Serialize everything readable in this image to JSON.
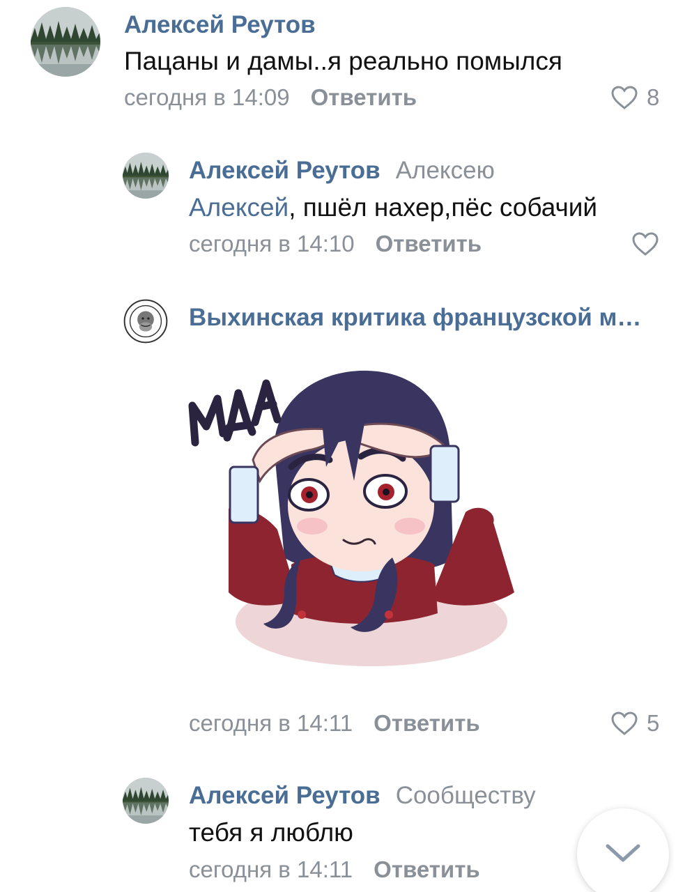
{
  "comments": [
    {
      "author": "Алексей Реутов",
      "text": "Пацаны и дамы..я реально помылся",
      "time": "сегодня в 14:09",
      "reply_label": "Ответить",
      "likes": "8"
    },
    {
      "author": "Алексей Реутов",
      "reply_to": "Алексею",
      "mention": "Алексей",
      "text": ", пшёл нахер,пёс собачий",
      "time": "сегодня в 14:10",
      "reply_label": "Ответить"
    },
    {
      "author": "Выхинская критика французской м…",
      "sticker_text": "МДА",
      "time": "сегодня в 14:11",
      "reply_label": "Ответить",
      "likes": "5"
    },
    {
      "author": "Алексей Реутов",
      "reply_to": "Сообществу",
      "text": "тебя я люблю",
      "time": "сегодня в 14:11",
      "reply_label": "Ответить"
    }
  ],
  "colors": {
    "link": "#4a6d96",
    "secondary": "#8a9097",
    "text": "#111111"
  },
  "icons": {
    "like": "heart-outline-icon",
    "scroll": "chevron-down-icon"
  }
}
